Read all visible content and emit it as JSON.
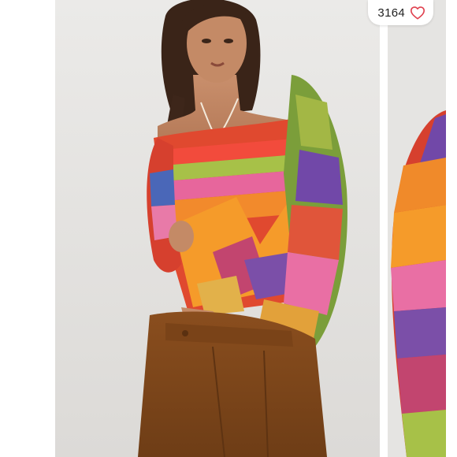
{
  "listing": {
    "like_count": "3164",
    "like_icon": "heart-outline-icon",
    "accent_color": "#e0414f"
  },
  "gallery": {
    "images": [
      {
        "subject": "model-in-colorful-knit-sweater-and-brown-trousers"
      },
      {
        "subject": "sweater-sleeve-closeup"
      }
    ]
  }
}
